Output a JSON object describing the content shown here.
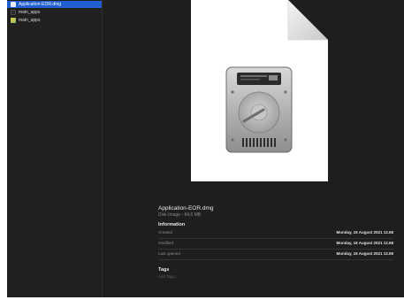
{
  "sidebar": {
    "items": [
      {
        "label": "Application-EOR.dmg",
        "icon": "disk-image-icon",
        "selected": true
      },
      {
        "label": "main_apps",
        "icon": "blank-file-icon",
        "selected": false
      },
      {
        "label": "main_apps",
        "icon": "app-icon",
        "selected": false
      }
    ]
  },
  "preview": {
    "file_name": "Application-EOR.dmg",
    "file_kind": "Disk Image - 84,6 MB",
    "information_heading": "Information",
    "info": [
      {
        "label": "Created",
        "value": "Monday, 16 August 2021 12.68"
      },
      {
        "label": "Modified",
        "value": "Monday, 16 August 2021 12.68"
      },
      {
        "label": "Last opened",
        "value": "Monday, 16 August 2021 12.68"
      }
    ],
    "tags_heading": "Tags",
    "tags_placeholder": "Add Tags..."
  },
  "colors": {
    "selection": "#1f5fd0",
    "window_bg": "#1e1e1e"
  }
}
